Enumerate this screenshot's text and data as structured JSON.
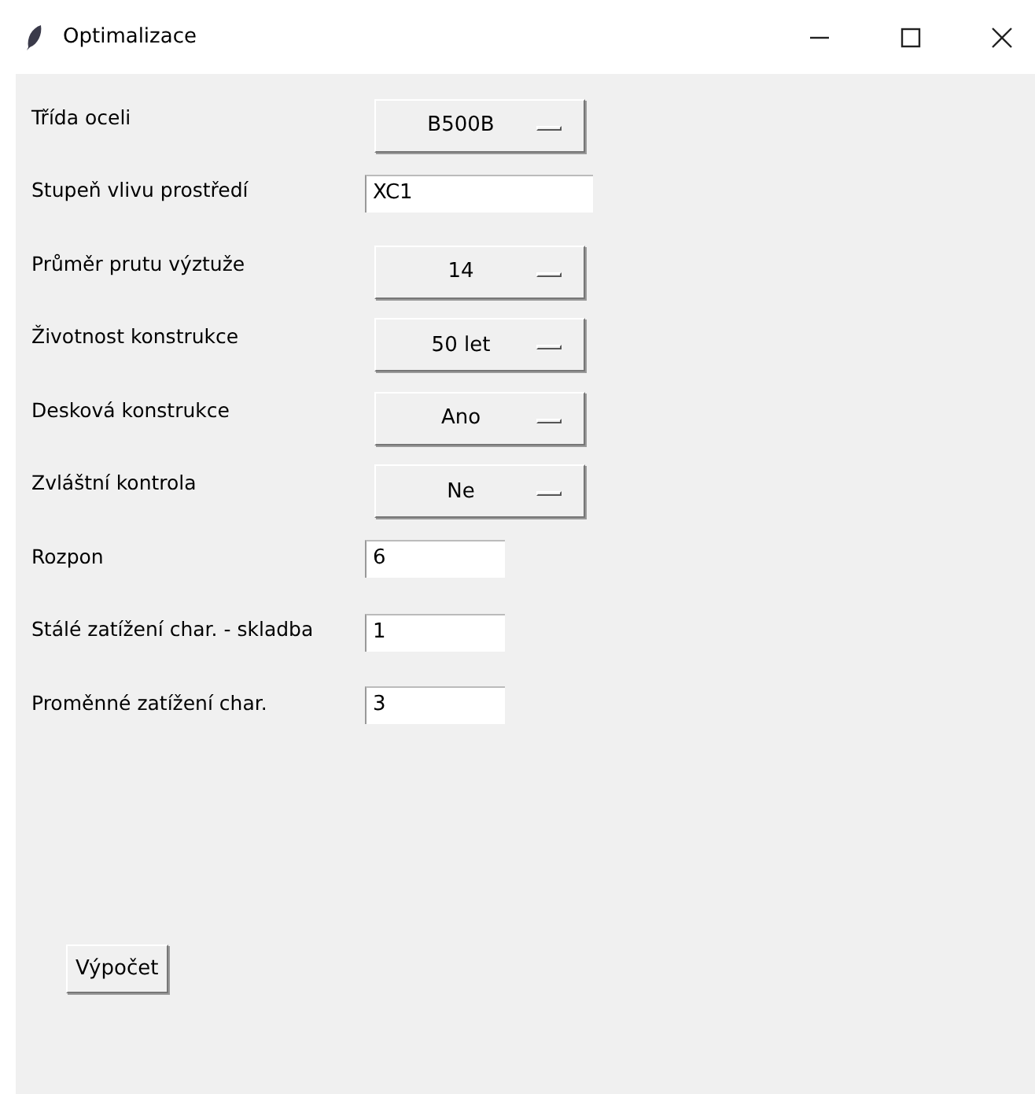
{
  "window": {
    "title": "Optimalizace"
  },
  "fields": [
    {
      "label": "Třída oceli",
      "kind": "select",
      "value": "B500B"
    },
    {
      "label": "Stupeň vlivu prostředí",
      "kind": "text",
      "value": "XC1"
    },
    {
      "label": "Průměr prutu výztuže",
      "kind": "select",
      "value": "14"
    },
    {
      "label": "Životnost konstrukce",
      "kind": "select",
      "value": "50 let"
    },
    {
      "label": "Desková konstrukce",
      "kind": "select",
      "value": "Ano"
    },
    {
      "label": "Zvláštní kontrola",
      "kind": "select",
      "value": "Ne"
    },
    {
      "label": "Rozpon",
      "kind": "number",
      "value": "6"
    },
    {
      "label": "Stálé zatížení char. - skladba",
      "kind": "number",
      "value": "1"
    },
    {
      "label": "Proměnné zatížení char.",
      "kind": "number",
      "value": "3"
    }
  ],
  "button": "Výpočet"
}
